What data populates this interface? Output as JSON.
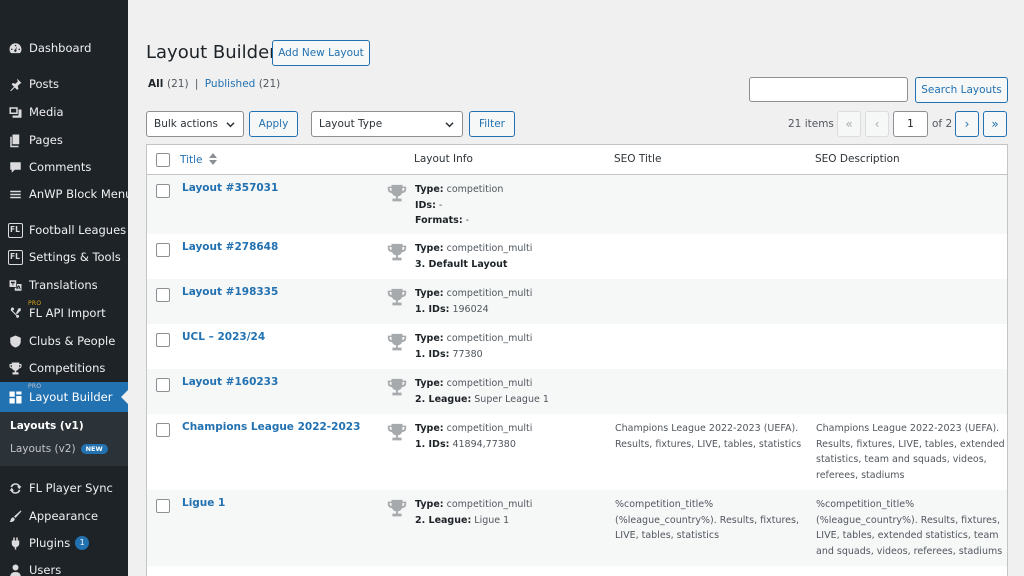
{
  "sidebar": {
    "items": [
      {
        "label": "Dashboard",
        "icon": "dashboard-icon"
      },
      {
        "label": "Posts",
        "icon": "pin-icon"
      },
      {
        "label": "Media",
        "icon": "media-icon"
      },
      {
        "label": "Pages",
        "icon": "pages-icon"
      },
      {
        "label": "Comments",
        "icon": "comment-icon"
      },
      {
        "label": "AnWP Block Menu",
        "icon": "menu-icon"
      },
      {
        "label": "Football Leagues",
        "icon": "fl-icon",
        "badge": "FL"
      },
      {
        "label": "Settings & Tools",
        "icon": "fl-icon",
        "badge": "FL"
      },
      {
        "label": "Translations",
        "icon": "translate-icon"
      },
      {
        "label": "FL API Import",
        "icon": "api-icon",
        "pro": "PRO"
      },
      {
        "label": "Clubs & People",
        "icon": "shield-icon"
      },
      {
        "label": "Competitions",
        "icon": "trophy-icon"
      },
      {
        "label": "Layout Builder",
        "icon": "layout-icon",
        "pro": "PRO"
      },
      {
        "label": "FL Player Sync",
        "icon": "sync-icon"
      },
      {
        "label": "Appearance",
        "icon": "brush-icon"
      },
      {
        "label": "Plugins",
        "icon": "plugin-icon",
        "count": "1"
      },
      {
        "label": "Users",
        "icon": "user-icon"
      }
    ],
    "submenu": [
      {
        "label": "Layouts (v1)"
      },
      {
        "label": "Layouts (v2)",
        "badge": "NEW"
      }
    ]
  },
  "header": {
    "title": "Layout Builder",
    "add_new_label": "Add New Layout"
  },
  "filters": {
    "all_label": "All",
    "all_count": "(21)",
    "separator": "|",
    "published_label": "Published",
    "published_count": "(21)"
  },
  "search": {
    "button_label": "Search Layouts",
    "value": ""
  },
  "toolbar": {
    "bulk_actions": "Bulk actions",
    "apply_label": "Apply",
    "layout_type": "Layout Type",
    "filter_label": "Filter"
  },
  "pagination": {
    "items": "21 items",
    "first": "«",
    "prev": "‹",
    "current": "1",
    "of": "of 2",
    "next": "›",
    "last": "»"
  },
  "table": {
    "columns": [
      "Title",
      "Layout Info",
      "SEO Title",
      "SEO Description"
    ],
    "rows": [
      {
        "title": "Layout #357031",
        "info": [
          {
            "k": "Type:",
            "v": "competition"
          },
          {
            "k": "IDs:",
            "v": "-"
          },
          {
            "k": "Formats:",
            "v": "-"
          }
        ],
        "seo_title": "",
        "seo_desc": ""
      },
      {
        "title": "Layout #278648",
        "info": [
          {
            "k": "Type:",
            "v": "competition_multi"
          },
          {
            "k": "3. Default Layout",
            "v": ""
          }
        ],
        "seo_title": "",
        "seo_desc": ""
      },
      {
        "title": "Layout #198335",
        "info": [
          {
            "k": "Type:",
            "v": "competition_multi"
          },
          {
            "k": "1. IDs:",
            "v": "196024"
          }
        ],
        "seo_title": "",
        "seo_desc": ""
      },
      {
        "title": "UCL – 2023/24",
        "info": [
          {
            "k": "Type:",
            "v": "competition_multi"
          },
          {
            "k": "1. IDs:",
            "v": "77380"
          }
        ],
        "seo_title": "",
        "seo_desc": ""
      },
      {
        "title": "Layout #160233",
        "info": [
          {
            "k": "Type:",
            "v": "competition_multi"
          },
          {
            "k": "2. League:",
            "v": "Super League 1"
          }
        ],
        "seo_title": "",
        "seo_desc": ""
      },
      {
        "title": "Champions League 2022-2023",
        "info": [
          {
            "k": "Type:",
            "v": "competition_multi"
          },
          {
            "k": "1. IDs:",
            "v": "41894,77380"
          }
        ],
        "seo_title": "Champions League 2022-2023 (UEFA). Results, fixtures, LIVE, tables, statistics",
        "seo_desc": "Champions League 2022-2023 (UEFA). Results, fixtures, LIVE, tables, extended statistics, team and squads, videos, referees, stadiums"
      },
      {
        "title": "Ligue 1",
        "info": [
          {
            "k": "Type:",
            "v": "competition_multi"
          },
          {
            "k": "2. League:",
            "v": "Ligue 1"
          }
        ],
        "seo_title": "%competition_title% (%league_country%). Results, fixtures, LIVE, tables, statistics",
        "seo_desc": "%competition_title% (%league_country%). Results, fixtures, LIVE, tables, extended statistics, team and squads, videos, referees, stadiums"
      }
    ]
  },
  "colors": {
    "sidebar_bg": "#1d2327",
    "accent": "#2271b1",
    "page_bg": "#f0f0f1"
  }
}
